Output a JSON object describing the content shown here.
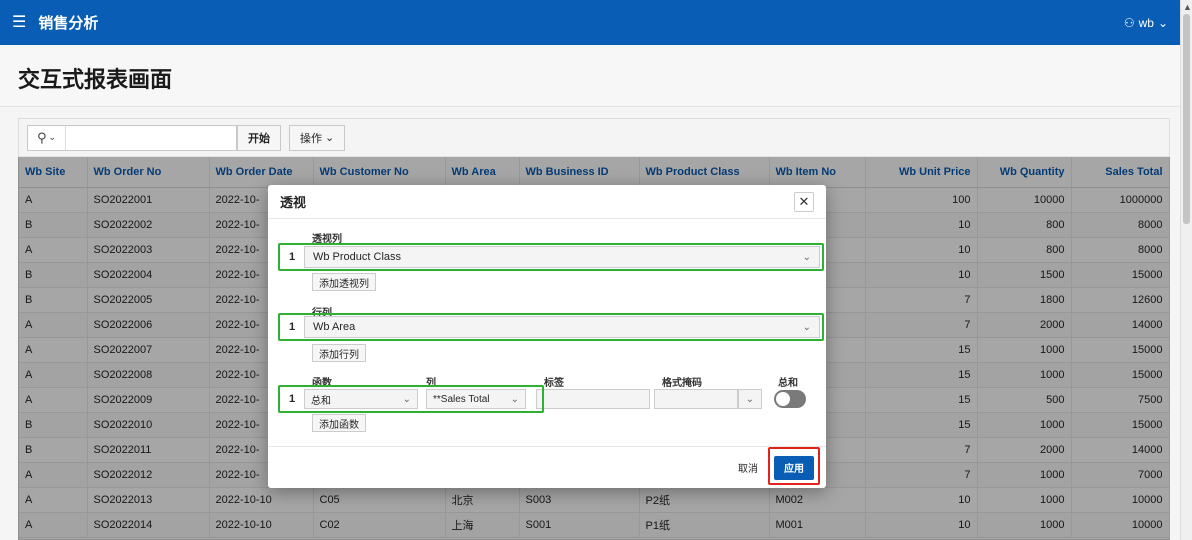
{
  "app": {
    "title": "销售分析",
    "user": "wb"
  },
  "page": {
    "title": "交互式报表画面"
  },
  "toolbar": {
    "search_placeholder": "",
    "go_label": "开始",
    "actions_label": "操作"
  },
  "table": {
    "columns": [
      "Wb Site",
      "Wb Order No",
      "Wb Order Date",
      "Wb Customer No",
      "Wb Area",
      "Wb Business ID",
      "Wb Product Class",
      "Wb Item No",
      "Wb Unit Price",
      "Wb Quantity",
      "Sales Total"
    ],
    "rows": [
      [
        "A",
        "SO2022001",
        "2022-10-",
        "",
        "",
        "",
        "",
        "",
        "100",
        "10000",
        "1000000"
      ],
      [
        "B",
        "SO2022002",
        "2022-10-",
        "",
        "",
        "",
        "",
        "",
        "10",
        "800",
        "8000"
      ],
      [
        "A",
        "SO2022003",
        "2022-10-",
        "",
        "",
        "",
        "",
        "",
        "10",
        "800",
        "8000"
      ],
      [
        "B",
        "SO2022004",
        "2022-10-",
        "",
        "",
        "",
        "",
        "",
        "10",
        "1500",
        "15000"
      ],
      [
        "B",
        "SO2022005",
        "2022-10-",
        "",
        "",
        "",
        "",
        "",
        "7",
        "1800",
        "12600"
      ],
      [
        "A",
        "SO2022006",
        "2022-10-",
        "",
        "",
        "",
        "",
        "",
        "7",
        "2000",
        "14000"
      ],
      [
        "A",
        "SO2022007",
        "2022-10-",
        "",
        "",
        "",
        "",
        "",
        "15",
        "1000",
        "15000"
      ],
      [
        "A",
        "SO2022008",
        "2022-10-",
        "",
        "",
        "",
        "",
        "",
        "15",
        "1000",
        "15000"
      ],
      [
        "A",
        "SO2022009",
        "2022-10-",
        "",
        "",
        "",
        "",
        "",
        "15",
        "500",
        "7500"
      ],
      [
        "B",
        "SO2022010",
        "2022-10-",
        "",
        "",
        "",
        "",
        "",
        "15",
        "1000",
        "15000"
      ],
      [
        "B",
        "SO2022011",
        "2022-10-",
        "",
        "",
        "",
        "",
        "",
        "7",
        "2000",
        "14000"
      ],
      [
        "A",
        "SO2022012",
        "2022-10-",
        "",
        "",
        "",
        "",
        "",
        "7",
        "1000",
        "7000"
      ],
      [
        "A",
        "SO2022013",
        "2022-10-10",
        "C05",
        "北京",
        "S003",
        "P2纸",
        "M002",
        "10",
        "1000",
        "10000"
      ],
      [
        "A",
        "SO2022014",
        "2022-10-10",
        "C02",
        "上海",
        "S001",
        "P1纸",
        "M001",
        "10",
        "1000",
        "10000"
      ]
    ]
  },
  "dialog": {
    "title": "透视",
    "pivot_label": "透视列",
    "pivot_index": "1",
    "pivot_value": "Wb Product Class",
    "add_pivot": "添加透视列",
    "row_label": "行列",
    "row_index": "1",
    "row_value": "Wb Area",
    "add_row": "添加行列",
    "func_label": "函数",
    "col_label": "列",
    "tag_label": "标签",
    "mask_label": "格式掩码",
    "sum_label": "总和",
    "func_index": "1",
    "func_value": "总和",
    "col_value": "**Sales Total",
    "add_func": "添加函数",
    "cancel": "取消",
    "apply": "应用"
  }
}
